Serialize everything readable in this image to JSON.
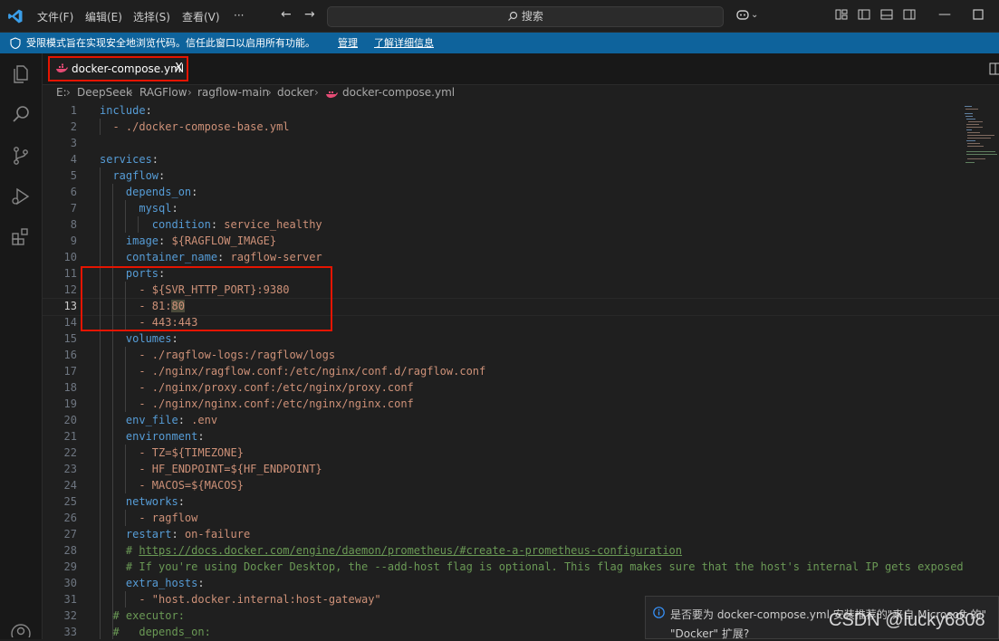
{
  "titlebar": {
    "menus": [
      "文件(F)",
      "编辑(E)",
      "选择(S)",
      "查看(V)",
      "···"
    ],
    "back": "←",
    "forward": "→",
    "search": "搜索"
  },
  "banner": {
    "text": "受限模式旨在实现安全地浏览代码。信任此窗口以启用所有功能。",
    "manage": "管理",
    "learn_more": "了解详细信息"
  },
  "tab": {
    "label": "docker-compose.yml",
    "close": "X"
  },
  "breadcrumb": [
    "E:",
    "DeepSeek",
    "RAGFlow",
    "ragflow-main",
    "docker",
    "docker-compose.yml"
  ],
  "editor": {
    "active_line": 13,
    "lines": [
      {
        "n": "1"
      },
      {
        "n": "2"
      },
      {
        "n": "3"
      },
      {
        "n": "4"
      },
      {
        "n": "5"
      },
      {
        "n": "6"
      },
      {
        "n": "7"
      },
      {
        "n": "8"
      },
      {
        "n": "9"
      },
      {
        "n": "10"
      },
      {
        "n": "11"
      },
      {
        "n": "12"
      },
      {
        "n": "13"
      },
      {
        "n": "14"
      },
      {
        "n": "15"
      },
      {
        "n": "16"
      },
      {
        "n": "17"
      },
      {
        "n": "18"
      },
      {
        "n": "19"
      },
      {
        "n": "20"
      },
      {
        "n": "21"
      },
      {
        "n": "22"
      },
      {
        "n": "23"
      },
      {
        "n": "24"
      },
      {
        "n": "25"
      },
      {
        "n": "26"
      },
      {
        "n": "27"
      },
      {
        "n": "28"
      },
      {
        "n": "29"
      },
      {
        "n": "30"
      },
      {
        "n": "31"
      },
      {
        "n": "32"
      },
      {
        "n": "33"
      }
    ],
    "code": {
      "l1k": "include",
      "l1p": ":",
      "l2": "  - ./docker-compose-base.yml",
      "l4k": "services",
      "l4p": ":",
      "l5k": "  ragflow",
      "l5p": ":",
      "l6k": "    depends_on",
      "l6p": ":",
      "l7k": "      mysql",
      "l7p": ":",
      "l8k": "        condition",
      "l8p": ": ",
      "l8v": "service_healthy",
      "l9k": "    image",
      "l9p": ": ",
      "l9v": "${RAGFLOW_IMAGE}",
      "l10k": "    container_name",
      "l10p": ": ",
      "l10v": "ragflow-server",
      "l11k": "    ports",
      "l11p": ":",
      "l12": "      - ${SVR_HTTP_PORT}:9380",
      "l13a": "      - 81:",
      "l13b": "80",
      "l14": "      - 443:443",
      "l15k": "    volumes",
      "l15p": ":",
      "l16": "      - ./ragflow-logs:/ragflow/logs",
      "l17": "      - ./nginx/ragflow.conf:/etc/nginx/conf.d/ragflow.conf",
      "l18": "      - ./nginx/proxy.conf:/etc/nginx/proxy.conf",
      "l19": "      - ./nginx/nginx.conf:/etc/nginx/nginx.conf",
      "l20k": "    env_file",
      "l20p": ": ",
      "l20v": ".env",
      "l21k": "    environment",
      "l21p": ":",
      "l22": "      - TZ=${TIMEZONE}",
      "l23": "      - HF_ENDPOINT=${HF_ENDPOINT}",
      "l24": "      - MACOS=${MACOS}",
      "l25k": "    networks",
      "l25p": ":",
      "l26": "      - ragflow",
      "l27k": "    restart",
      "l27p": ": ",
      "l27v": "on-failure",
      "l28a": "    # ",
      "l28b": "https://docs.docker.com/engine/daemon/prometheus/#create-a-prometheus-configuration",
      "l29": "    # If you're using Docker Desktop, the --add-host flag is optional. This flag makes sure that the host's internal IP gets exposed",
      "l30k": "    extra_hosts",
      "l30p": ":",
      "l31": "      - \"host.docker.internal:host-gateway\"",
      "l32": "  # executor:",
      "l33": "  #   depends_on:"
    }
  },
  "notification": {
    "line1": "是否要为 docker-compose.yml 安装推荐的\"来自 Microsoft 的\"",
    "line2": "\"Docker\" 扩展?"
  },
  "watermark": "CSDN @lucky6808",
  "colors": {
    "keyword": "#569cd6",
    "string": "#ce9178",
    "comment": "#6a9955",
    "banner": "#0e639c",
    "highlight_box": "#e51400"
  }
}
